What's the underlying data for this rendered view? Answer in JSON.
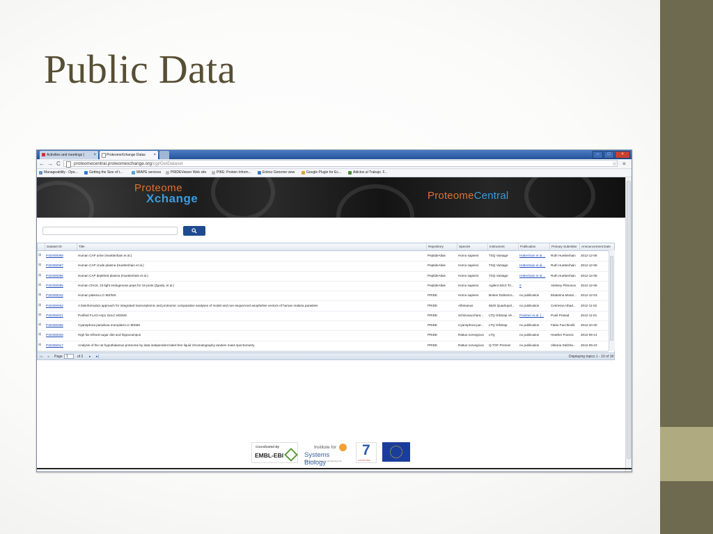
{
  "slide": {
    "title": "Public Data"
  },
  "browser": {
    "tabs": [
      {
        "label": "Activities and meetings (",
        "close": "×"
      },
      {
        "label": "ProteomeXchange Datas",
        "close": "×"
      }
    ],
    "url": {
      "host": "proteomecentral.proteomexchange.org",
      "path": "/cgi/GetDataset"
    },
    "nav": {
      "back": "←",
      "forward": "→",
      "reload": "C",
      "star": "☆",
      "menu": "≡"
    },
    "window_buttons": [
      "–",
      "□",
      "×"
    ],
    "bookmarks": [
      {
        "label": "Manageability - Ope...",
        "color": "#6a8fc4"
      },
      {
        "label": "Getting the Size of t...",
        "color": "#2b7bd0"
      },
      {
        "label": "MIAPE services",
        "color": "#5aa0d8"
      },
      {
        "label": "PRIDEViewer Web site",
        "color": "#bbbbbb"
      },
      {
        "label": "PIKE: Protein Inform...",
        "color": "#bbbbbb"
      },
      {
        "label": "Entrez Genome view",
        "color": "#3c7ac4"
      },
      {
        "label": "Google Plugin for Ec...",
        "color": "#e1a23a"
      },
      {
        "label": "Adictos al Trabajo. F...",
        "color": "#4a8a3a"
      }
    ]
  },
  "header": {
    "px_logo_top": "Proteome",
    "px_logo_bottom": "Xchange",
    "pc_logo_a": "Proteome",
    "pc_logo_b": "Central"
  },
  "search": {
    "placeholder": "",
    "button_icon": "search-icon"
  },
  "grid": {
    "columns": [
      "Dataset ID",
      "Title",
      "Repository",
      "Species",
      "Instrument",
      "Publication",
      "Primary Submitter",
      "Announcement Date"
    ],
    "rows": [
      {
        "id": "PXD000088",
        "title": "Human CAP urine (Huettenhain et al.)",
        "repo": "PeptideAtlas",
        "species": "Homo sapiens",
        "instrument": "TSQ Vantage",
        "publication": "Hüttenhain et al....",
        "pub_link": true,
        "submitter": "Ruth Huettenhain",
        "date": "2012-12-06"
      },
      {
        "id": "PXD000087",
        "title": "Human CAP crude plasma (Huettenhain et al.)",
        "repo": "PeptideAtlas",
        "species": "Homo sapiens",
        "instrument": "TSQ Vantage",
        "publication": "Hüttenhain et al....",
        "pub_link": true,
        "submitter": "Ruth Huettenhain",
        "date": "2012-12-06"
      },
      {
        "id": "PXD000086",
        "title": "Human CAP depleted plasma (Huettenhain et al.)",
        "repo": "PeptideAtlas",
        "species": "Homo sapiens",
        "instrument": "TSQ Vantage",
        "publication": "Hüttenhain et al....",
        "pub_link": true,
        "submitter": "Ruth Huettenhain",
        "date": "2012-12-06"
      },
      {
        "id": "PXD000085",
        "title": "Human Chr16. 23 light endogenous peps for 19 prots (Zgoda, et al.)",
        "repo": "PeptideAtlas",
        "species": "Homo sapiens",
        "instrument": "Agilent 6410 Tri...",
        "publication": "0",
        "pub_link": true,
        "submitter": "Aleksey Plimonov",
        "date": "2012-12-06"
      },
      {
        "id": "PXD000042",
        "title": "Human plasma LC-MS/MS",
        "repo": "PRIDE",
        "species": "Homo sapiens",
        "instrument": "Bruker Daltonics...",
        "publication": "no publication",
        "pub_link": false,
        "submitter": "Ekaterina Mosto...",
        "date": "2012-12-03"
      },
      {
        "id": "PXD000062",
        "title": "A bioinformatics approach for integrated transcriptomic and proteomic comparative analyses of model and non-sequenced anopheline vectors of human malaria parasites",
        "repo": "PRIDE",
        "species": "Albimanus",
        "instrument": "6520 Quadrupol...",
        "publication": "no publication",
        "pub_link": false,
        "submitter": "Cesresna Ubad...",
        "date": "2012-11-02"
      },
      {
        "id": "PXD000021",
        "title": "Purified FLAG-Hrp1 GeLC-MS/MS",
        "repo": "PRIDE",
        "species": "Schizosacchara...",
        "instrument": "LTQ Orbitrap Ve...",
        "publication": "Pointner et al. (...",
        "pub_link": true,
        "submitter": "Punit Prasad",
        "date": "2012-11-01"
      },
      {
        "id": "PXD000056",
        "title": "Cyanophora paradoxa muroplast LC-MSMS",
        "repo": "PRIDE",
        "species": "Cyanophora par...",
        "instrument": "LTQ Orbitrap",
        "publication": "no publication",
        "pub_link": false,
        "submitter": "Fabio Facchinelli",
        "date": "2012-10-30"
      },
      {
        "id": "PXD000028",
        "title": "High fat refined sugar diet and hippocampus",
        "repo": "PRIDE",
        "species": "Rattus norvegicus",
        "instrument": "LTQ",
        "publication": "no publication",
        "pub_link": false,
        "submitter": "Heather Francis",
        "date": "2012-09-14"
      },
      {
        "id": "PXD000017",
        "title": "Analysis of the rat hypothalamus proteome by data independent label-free liquid chromatography tandem mass spectrometry",
        "repo": "PRIDE",
        "species": "Rattus norvegicus",
        "instrument": "Q-TOF Premier",
        "publication": "no publication",
        "pub_link": false,
        "submitter": "Viktoria Stelzha...",
        "date": "2012-09-23"
      }
    ]
  },
  "pager": {
    "page_label": "Page",
    "page_value": "1",
    "of_label": "of 2",
    "status": "Displaying topics 1 - 10 of 18"
  },
  "footer": {
    "embl_caption": "Coordinated By",
    "embl_name": "EMBL-EBI",
    "isb_line1": "Institute for",
    "isb_line2": "Systems Biology",
    "isb_tagline": "Revolutionizing Science. Enhancing Life.",
    "fp7_number": "7",
    "fp7_caption": "CAPACITIES"
  }
}
